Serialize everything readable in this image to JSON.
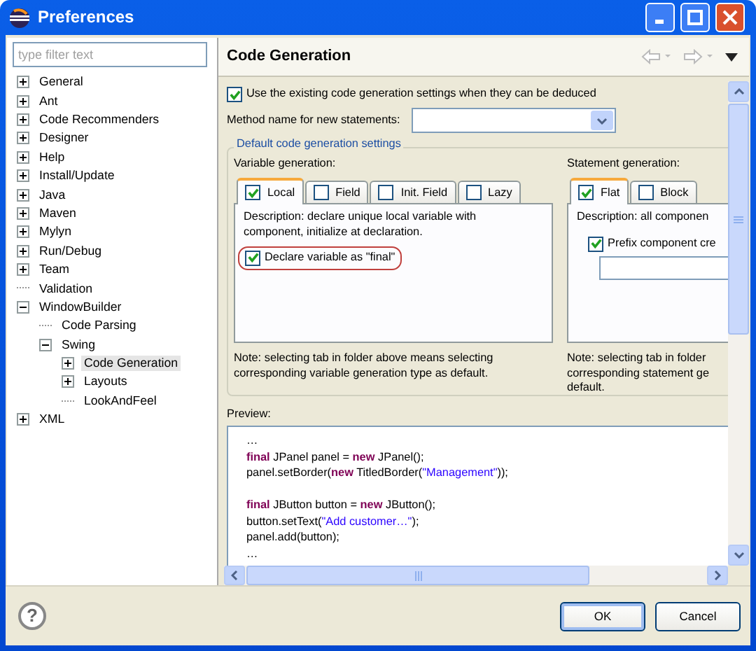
{
  "window": {
    "title": "Preferences"
  },
  "filter": {
    "placeholder": "type filter text"
  },
  "tree": [
    {
      "label": "General",
      "kind": "branch",
      "expanded": false,
      "selected": false
    },
    {
      "label": "Ant",
      "kind": "branch",
      "expanded": false,
      "selected": false
    },
    {
      "label": "Code Recommenders",
      "kind": "branch",
      "expanded": false,
      "selected": false
    },
    {
      "label": "Designer",
      "kind": "branch",
      "expanded": false,
      "selected": false
    },
    {
      "label": "Help",
      "kind": "branch",
      "expanded": false,
      "selected": false
    },
    {
      "label": "Install/Update",
      "kind": "branch",
      "expanded": false,
      "selected": false
    },
    {
      "label": "Java",
      "kind": "branch",
      "expanded": false,
      "selected": false
    },
    {
      "label": "Maven",
      "kind": "branch",
      "expanded": false,
      "selected": false
    },
    {
      "label": "Mylyn",
      "kind": "branch",
      "expanded": false,
      "selected": false
    },
    {
      "label": "Run/Debug",
      "kind": "branch",
      "expanded": false,
      "selected": false
    },
    {
      "label": "Team",
      "kind": "branch",
      "expanded": false,
      "selected": false
    },
    {
      "label": "Validation",
      "kind": "leaf",
      "selected": false
    },
    {
      "label": "WindowBuilder",
      "kind": "branch",
      "expanded": true,
      "selected": false,
      "children": [
        {
          "label": "Code Parsing",
          "kind": "leaf",
          "selected": false
        },
        {
          "label": "Swing",
          "kind": "branch",
          "expanded": true,
          "selected": false,
          "children": [
            {
              "label": "Code Generation",
              "kind": "branch",
              "expanded": false,
              "selected": true
            },
            {
              "label": "Layouts",
              "kind": "branch",
              "expanded": false,
              "selected": false
            },
            {
              "label": "LookAndFeel",
              "kind": "leaf",
              "selected": false
            }
          ]
        }
      ]
    },
    {
      "label": "XML",
      "kind": "branch",
      "expanded": false,
      "selected": false
    }
  ],
  "page": {
    "title": "Code Generation",
    "use_existing": {
      "label": "Use the existing code generation settings when they can be deduced",
      "checked": true
    },
    "method_name": {
      "label": "Method name for new statements:"
    },
    "group": {
      "title": "Default code generation settings",
      "variable": {
        "label": "Variable generation:",
        "tabs": [
          {
            "label": "Local",
            "checked": true,
            "selected": true
          },
          {
            "label": "Field",
            "checked": false,
            "selected": false
          },
          {
            "label": "Init. Field",
            "checked": false,
            "selected": false
          },
          {
            "label": "Lazy",
            "checked": false,
            "selected": false
          }
        ],
        "description": [
          "Description: declare unique local variable with",
          "component, initialize at declaration."
        ],
        "option": {
          "label": "Declare variable as \"final\"",
          "checked": true,
          "highlighted": true
        },
        "note": [
          "Note: selecting tab in folder above means selecting",
          "corresponding variable generation type as default."
        ]
      },
      "statement": {
        "label": "Statement generation:",
        "tabs": [
          {
            "label": "Flat",
            "checked": true,
            "selected": true
          },
          {
            "label": "Block",
            "checked": false,
            "selected": false
          }
        ],
        "description": [
          "Description: all componen"
        ],
        "option": {
          "label": "Prefix component cre",
          "checked": true
        },
        "note": [
          "Note: selecting tab in folder",
          "corresponding statement ge",
          "default."
        ]
      }
    },
    "preview": {
      "label": "Preview:",
      "lines": [
        {
          "kind": "code",
          "tokens": [
            {
              "kind": "plain",
              "text": "…"
            }
          ]
        },
        {
          "kind": "code",
          "tokens": [
            {
              "kind": "keyword",
              "text": "final"
            },
            {
              "kind": "plain",
              "text": " JPanel panel = "
            },
            {
              "kind": "keyword",
              "text": "new"
            },
            {
              "kind": "plain",
              "text": " JPanel();"
            }
          ]
        },
        {
          "kind": "code",
          "tokens": [
            {
              "kind": "plain",
              "text": "panel.setBorder("
            },
            {
              "kind": "keyword",
              "text": "new"
            },
            {
              "kind": "plain",
              "text": " TitledBorder("
            },
            {
              "kind": "string",
              "text": "\"Management\""
            },
            {
              "kind": "plain",
              "text": "));"
            }
          ]
        },
        {
          "kind": "blank"
        },
        {
          "kind": "code",
          "tokens": [
            {
              "kind": "keyword",
              "text": "final"
            },
            {
              "kind": "plain",
              "text": " JButton button = "
            },
            {
              "kind": "keyword",
              "text": "new"
            },
            {
              "kind": "plain",
              "text": " JButton();"
            }
          ]
        },
        {
          "kind": "code",
          "tokens": [
            {
              "kind": "plain",
              "text": "button.setText("
            },
            {
              "kind": "string",
              "text": "\"Add customer…\""
            },
            {
              "kind": "plain",
              "text": ");"
            }
          ]
        },
        {
          "kind": "code",
          "tokens": [
            {
              "kind": "plain",
              "text": "panel.add(button);"
            }
          ]
        },
        {
          "kind": "code",
          "tokens": [
            {
              "kind": "plain",
              "text": "…"
            }
          ]
        }
      ]
    }
  },
  "help": {
    "label": "?"
  },
  "buttons": [
    {
      "label": "OK",
      "kind": "default"
    },
    {
      "label": "Cancel",
      "kind": "normal"
    }
  ]
}
